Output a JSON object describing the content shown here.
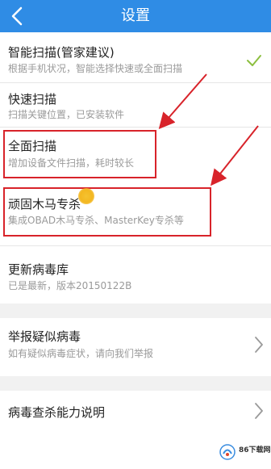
{
  "header": {
    "title": "设置"
  },
  "items": [
    {
      "title": "智能扫描(管家建议)",
      "subtitle": "根据手机状况，智能选择快速或全面扫描"
    },
    {
      "title": "快速扫描",
      "subtitle": "扫描关键位置，已安装软件"
    },
    {
      "title": "全面扫描",
      "subtitle": "增加设备文件扫描，耗时较长"
    },
    {
      "title": "顽固木马专杀",
      "subtitle": "集成OBAD木马专杀、MasterKey专杀等"
    },
    {
      "title": "更新病毒库",
      "subtitle": "已是最新，版本20150122B"
    },
    {
      "title": "举报疑似病毒",
      "subtitle": "如有疑似病毒症状，请向我们举报"
    },
    {
      "title": "病毒查杀能力说明",
      "subtitle": ""
    }
  ],
  "watermark": {
    "text": "86下载网"
  },
  "colors": {
    "header": "#2f8ce5",
    "highlight": "#d8232a",
    "check": "#8cbf3f"
  },
  "icons": [
    "back-arrow-icon",
    "checkmark-icon",
    "chevron-right-icon"
  ]
}
